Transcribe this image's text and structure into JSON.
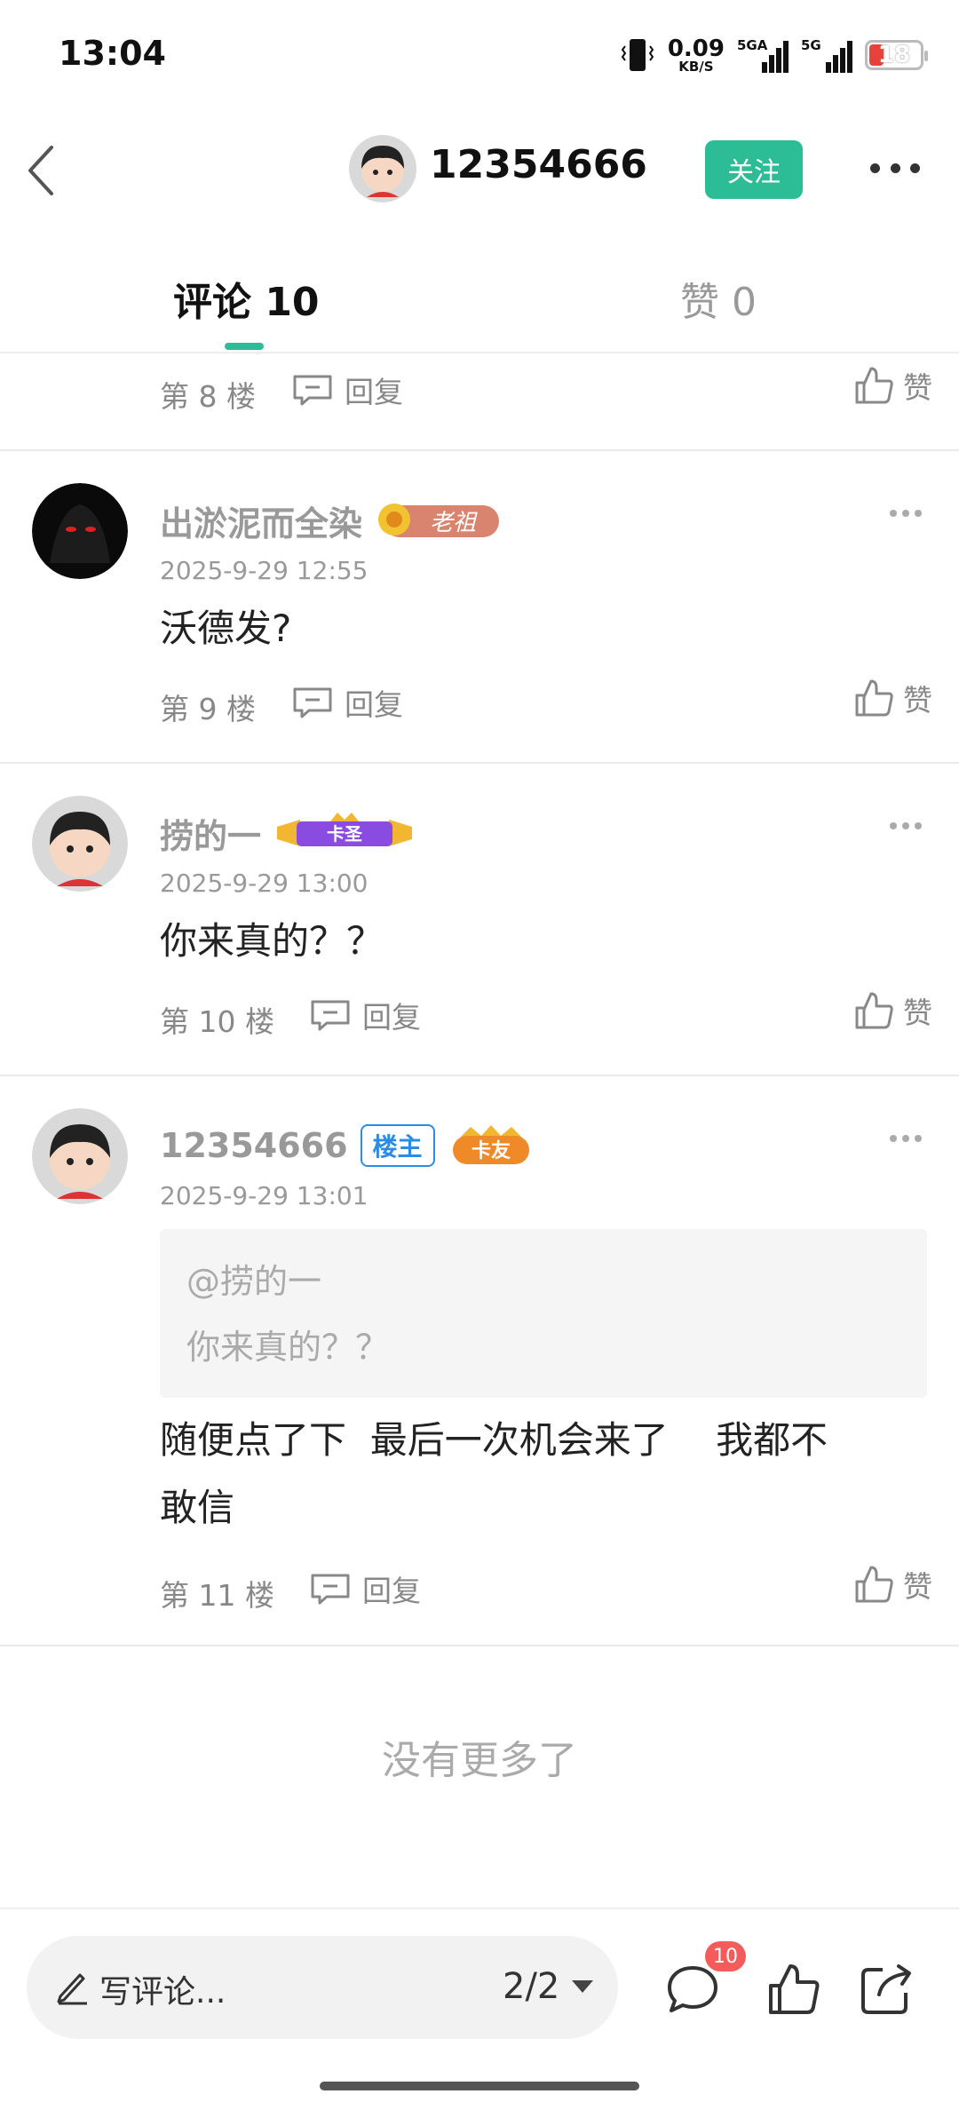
{
  "status_bar": {
    "time": "13:04",
    "net_speed": "0.09",
    "net_unit": "KB/S",
    "sig1_label": "5GA",
    "sig2_label": "5G",
    "battery": "18",
    "icons": [
      "vibrate-icon",
      "signal-icon",
      "battery-icon"
    ]
  },
  "header": {
    "username": "12354666",
    "follow_label": "关注"
  },
  "tabs": {
    "comments": "评论 10",
    "likes": "赞 0"
  },
  "floors": {
    "f8": {
      "floor": "第 8 楼",
      "reply": "回复",
      "like": "赞"
    }
  },
  "comments": [
    {
      "name": "出淤泥而全染",
      "badge": "老祖",
      "date": "2025-9-29 12:55",
      "text": "沃德发?",
      "floor": "第 9 楼",
      "reply": "回复",
      "like": "赞"
    },
    {
      "name": "捞的一",
      "badge": "卡圣",
      "date": "2025-9-29 13:00",
      "text": "你来真的？？",
      "floor": "第 10 楼",
      "reply": "回复",
      "like": "赞"
    },
    {
      "name": "12354666",
      "owner_badge": "楼主",
      "badge": "卡友",
      "date": "2025-9-29 13:01",
      "quote_at": "@捞的一",
      "quote_text": "你来真的？？",
      "text_line1": "随便点了下  最后一次机会来了    我都不",
      "text_line2": "敢信",
      "floor": "第 11 楼",
      "reply": "回复",
      "like": "赞"
    }
  ],
  "no_more": "没有更多了",
  "bottom_bar": {
    "write_label": "写评论...",
    "page": "2/2",
    "comment_count": "10"
  },
  "colors": {
    "accent": "#2dbd96",
    "owner_badge": "#2b8ce8",
    "count_badge": "#f45c5c"
  }
}
